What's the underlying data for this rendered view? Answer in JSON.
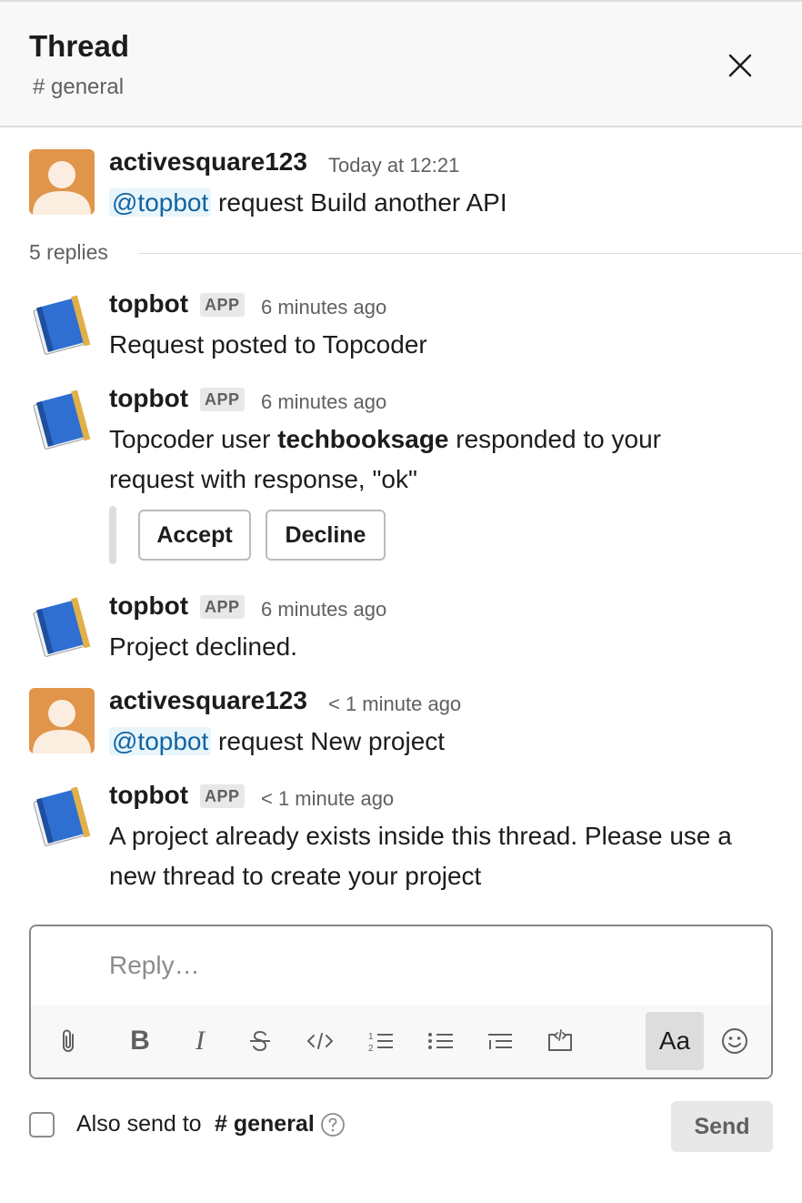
{
  "header": {
    "title": "Thread",
    "channel": "# general",
    "close_icon": "close-icon"
  },
  "parent_message": {
    "author": "activesquare123",
    "time": "Today at 12:21",
    "mention": "@topbot",
    "text": " request Build another API",
    "avatar_icon": "user-avatar-icon"
  },
  "replies_label": "5 replies",
  "app_badge": "APP",
  "replies": [
    {
      "author": "topbot",
      "time": "6 minutes ago",
      "text": "Request posted to Topcoder"
    },
    {
      "author": "topbot",
      "time": "6 minutes ago",
      "text_before": "Topcoder user ",
      "text_bold": "techbooksage",
      "text_after": " responded to your",
      "text_line2": "request with response, \"ok\"",
      "actions": {
        "accept": "Accept",
        "decline": "Decline"
      }
    },
    {
      "author": "topbot",
      "time": "6 minutes ago",
      "text": "Project declined."
    },
    {
      "author": "activesquare123",
      "time": "< 1 minute ago",
      "mention": "@topbot",
      "text": " request New project"
    },
    {
      "author": "topbot",
      "time": "< 1 minute ago",
      "text_line1": "A project already exists inside this thread. Please use a",
      "text_line2": "new thread to create your project"
    }
  ],
  "composer": {
    "placeholder": "Reply…",
    "toolbar_icons": [
      "paperclip-icon",
      "bold-icon",
      "italic-icon",
      "strikethrough-icon",
      "code-icon",
      "ordered-list-icon",
      "bulleted-list-icon",
      "blockquote-icon",
      "code-block-icon",
      "formatting-toggle-icon",
      "emoji-icon"
    ],
    "format_toggle_label": "Aa"
  },
  "also_send": {
    "label": "Also send to",
    "channel": "# general",
    "checked": false
  },
  "send_label": "Send",
  "colors": {
    "mention_bg": "#e8f5fa",
    "mention_text": "#1264a3",
    "user_avatar": "#e0954a",
    "bot_book": "#2f6fd1"
  }
}
